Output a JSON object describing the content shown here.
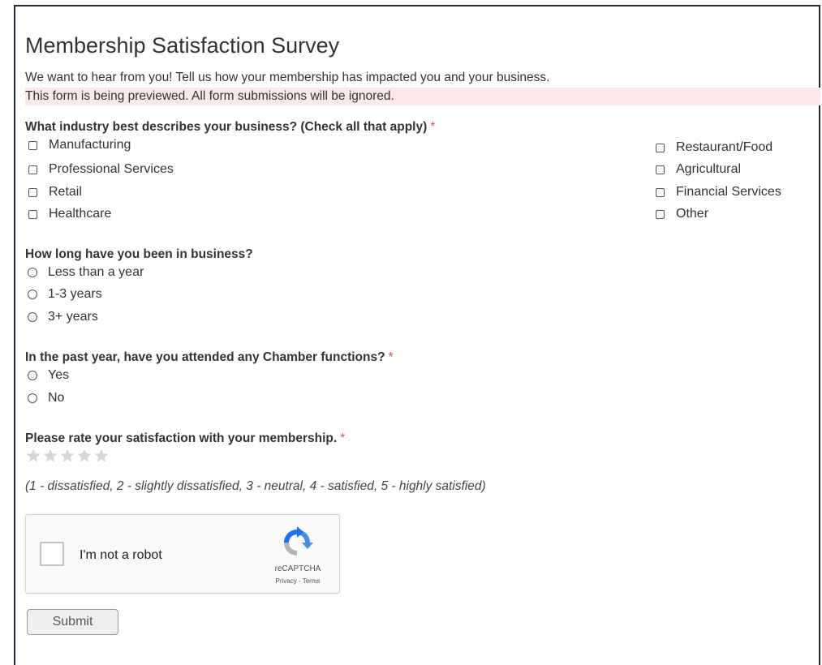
{
  "form": {
    "title": "Membership Satisfaction Survey",
    "description": "We want to hear from you! Tell us how your membership has impacted you and your business.",
    "preview_notice": "This form is being previewed. All form submissions will be ignored."
  },
  "questions": {
    "industry": {
      "label": "What industry best describes your business? (Check all that apply)",
      "required_mark": "*",
      "options_left": [
        "Manufacturing",
        "Professional Services",
        "Retail",
        "Healthcare"
      ],
      "options_right": [
        "Restaurant/Food",
        "Agricultural",
        "Financial Services",
        "Other"
      ]
    },
    "years": {
      "label": "How long have you been in business?",
      "options": [
        "Less than a year",
        "1-3 years",
        "3+ years"
      ]
    },
    "functions": {
      "label": "In the past year, have you attended any Chamber functions?",
      "required_mark": "*",
      "options": [
        "Yes",
        "No"
      ]
    },
    "rating": {
      "label": "Please rate your satisfaction with your membership.",
      "required_mark": "*",
      "max_stars": 5,
      "selected": 0,
      "hint": "(1 - dissatisfied, 2 - slightly dissatisfied, 3 - neutral, 4 - satisfied, 5 - highly satisfied)"
    }
  },
  "captcha": {
    "label": "I'm not a robot",
    "brand": "reCAPTCHA",
    "privacy": "Privacy",
    "separator": " - ",
    "terms": "Terms",
    "icon": "recaptcha-logo-icon"
  },
  "submit_label": "Submit",
  "colors": {
    "required": "#d9534f",
    "preview_bg": "#fbe9ea",
    "star_empty": "#d6d6d6",
    "frame_border": "#1f2a36"
  }
}
